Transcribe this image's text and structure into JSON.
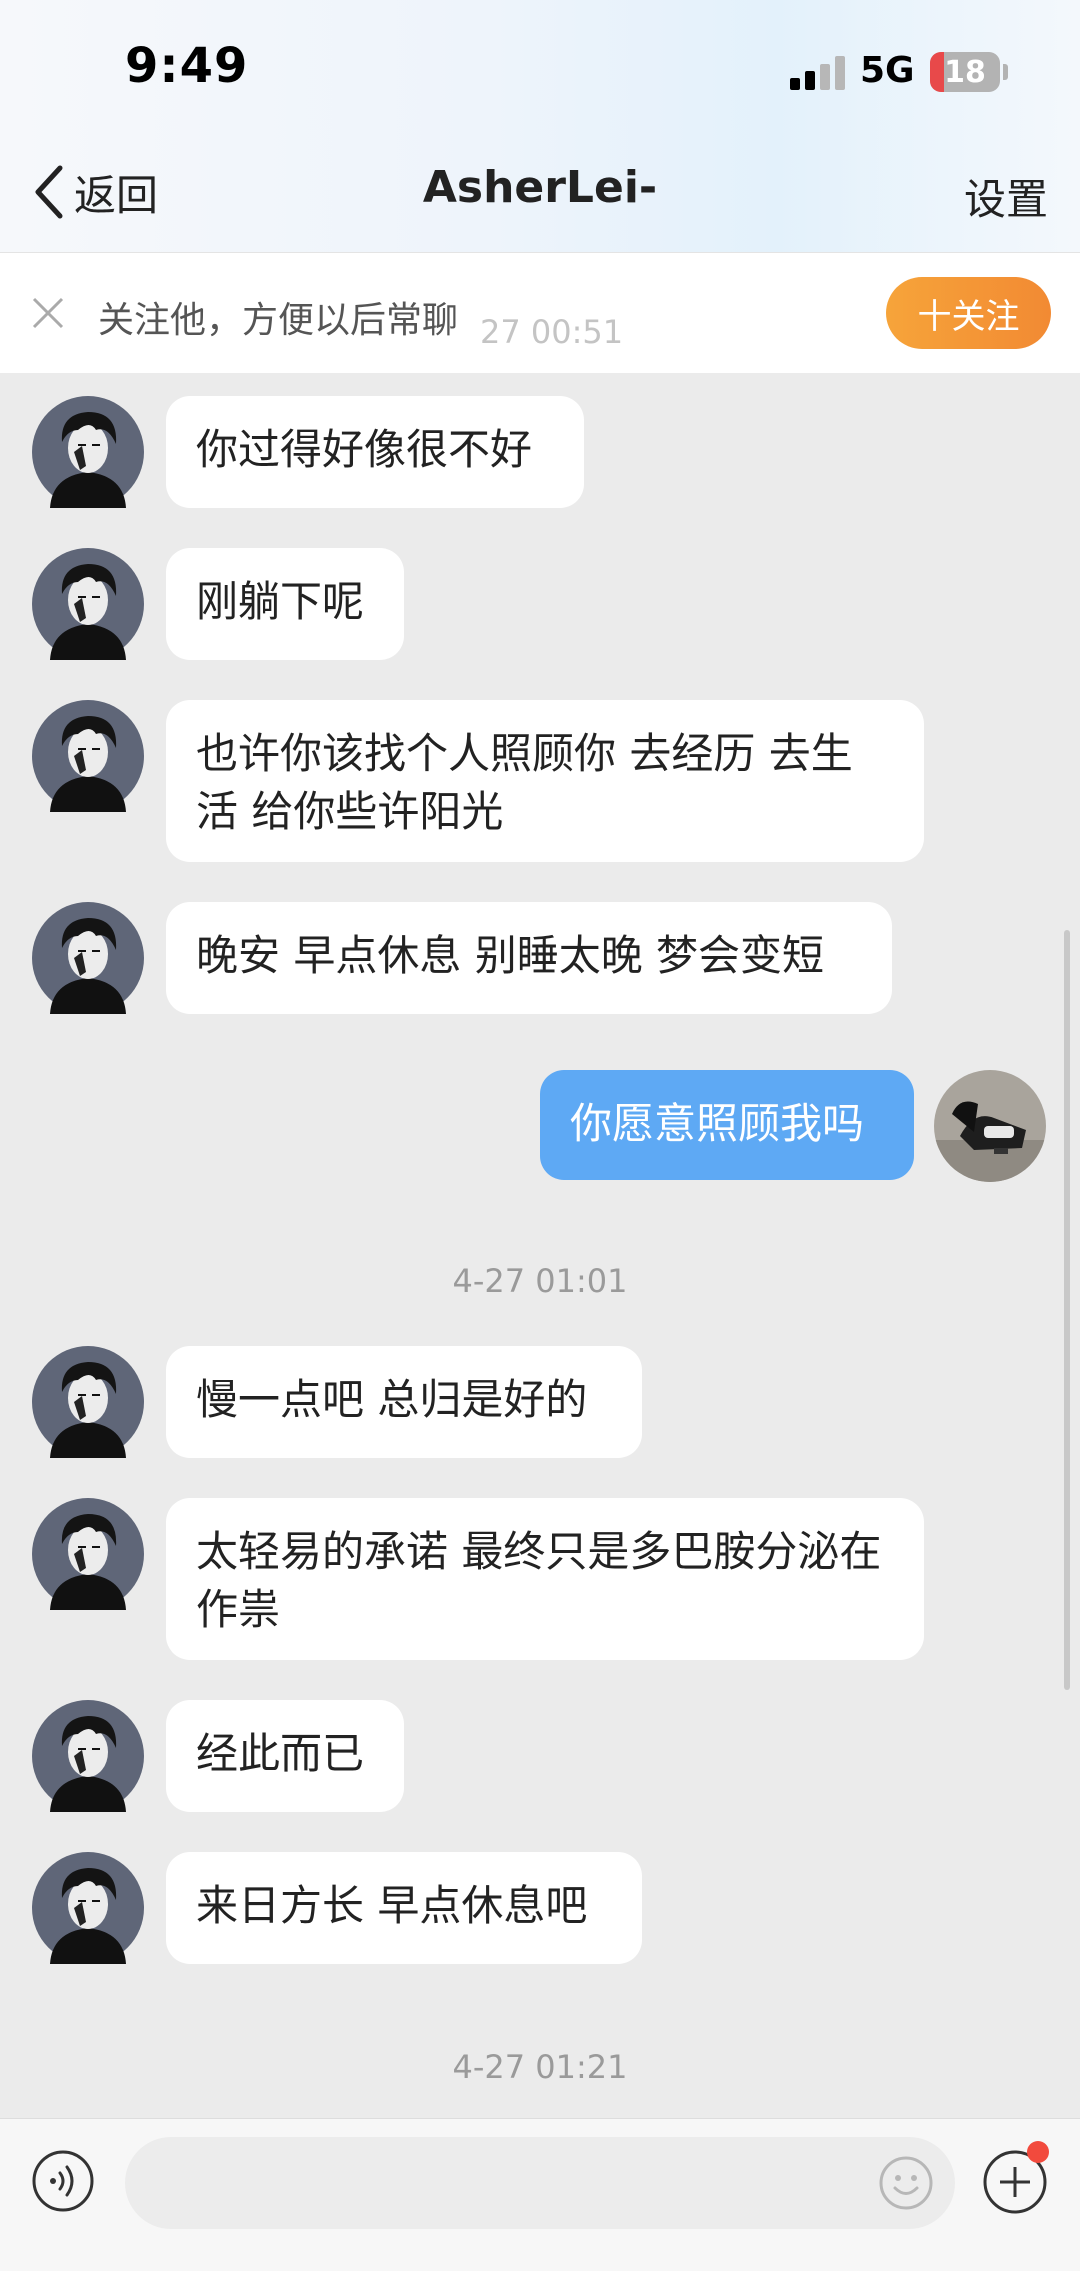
{
  "status_bar": {
    "time": "9:49",
    "network": "5G",
    "battery": "18",
    "signal_bars": 2,
    "signal_max": 4
  },
  "nav": {
    "back_label": "返回",
    "title": "AsherLei-",
    "settings_label": "设置"
  },
  "follow_bar": {
    "text": "关注他，方便以后常聊",
    "button_label": "十关注",
    "hidden_timestamp": "27 00:51"
  },
  "messages": [
    {
      "from": "them",
      "text": "你过得好像很不好"
    },
    {
      "from": "them",
      "text": "刚躺下呢"
    },
    {
      "from": "them",
      "text": "也许你该找个人照顾你 去经历 去生活 给你些许阳光"
    },
    {
      "from": "them",
      "text": "晚安 早点休息 别睡太晚 梦会变短"
    },
    {
      "from": "me",
      "text": "你愿意照顾我吗"
    },
    {
      "from": "time",
      "text": "4-27 01:01"
    },
    {
      "from": "them",
      "text": "慢一点吧 总归是好的"
    },
    {
      "from": "them",
      "text": "太轻易的承诺 最终只是多巴胺分泌在作祟"
    },
    {
      "from": "them",
      "text": "经此而已"
    },
    {
      "from": "them",
      "text": "来日方长 早点休息吧"
    },
    {
      "from": "time",
      "text": "4-27 01:21"
    }
  ],
  "input": {
    "placeholder": ""
  },
  "colors": {
    "outgoing_bubble": "#5ea9f4",
    "incoming_bubble": "#ffffff",
    "follow_button": "#f28a33",
    "background": "#ebebeb"
  }
}
